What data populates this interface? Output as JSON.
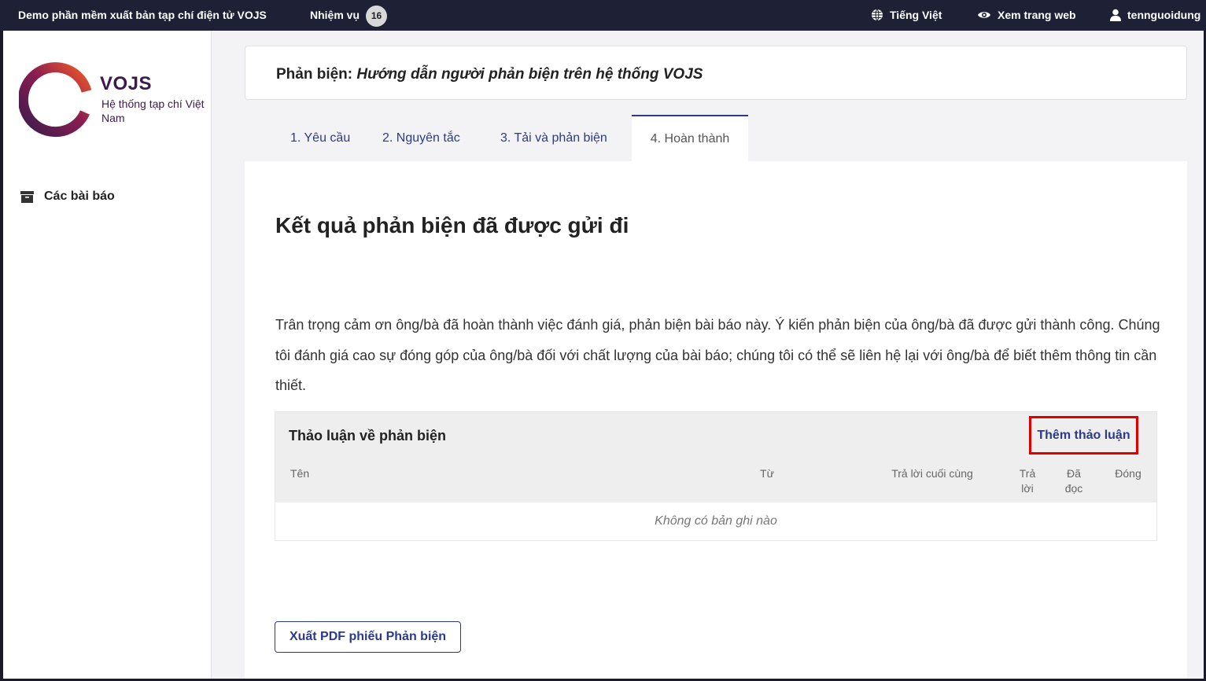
{
  "topbar": {
    "site_name": "Demo phần mềm xuất bản tạp chí điện tử VOJS",
    "tasks_label": "Nhiệm vụ",
    "tasks_count": "16",
    "language": "Tiếng Việt",
    "view_site": "Xem trang web",
    "username": "tennguoidung"
  },
  "sidebar": {
    "logo_title": "VOJS",
    "logo_subtitle": "Hệ thống tạp chí Việt Nam",
    "items": [
      {
        "label": "Các bài báo",
        "icon": "archive-icon"
      }
    ]
  },
  "header": {
    "prefix": "Phản biện:",
    "title": "Hướng dẫn người phản biện trên hệ thống VOJS"
  },
  "tabs": [
    {
      "label": "1. Yêu cầu"
    },
    {
      "label": "2. Nguyên tắc"
    },
    {
      "label": "3. Tải và phản biện"
    },
    {
      "label": "4. Hoàn thành",
      "active": true
    }
  ],
  "main": {
    "heading": "Kết quả phản biện đã được gửi đi",
    "paragraph": "Trân trọng cảm ơn ông/bà đã hoàn thành việc đánh giá, phản biện bài báo này. Ý kiến phản biện của ông/bà đã được gửi thành công. Chúng tôi đánh giá cao sự đóng góp của ông/bà đối với chất lượng của bài báo; chúng tôi có thể sẽ liên hệ lại với ông/bà để biết thêm thông tin cần thiết."
  },
  "discussion": {
    "title": "Thảo luận về phản biện",
    "add_label": "Thêm thảo luận",
    "columns": [
      "Tên",
      "Từ",
      "Trả lời cuối cùng",
      "Trả lời",
      "Đã đọc",
      "Đóng"
    ],
    "empty_text": "Không có bản ghi nào"
  },
  "actions": {
    "export_pdf": "Xuất PDF phiếu Phản biện"
  },
  "colors": {
    "topbar_bg": "#1e2135",
    "accent": "#2b3a8a",
    "highlight_border": "#e00000"
  }
}
